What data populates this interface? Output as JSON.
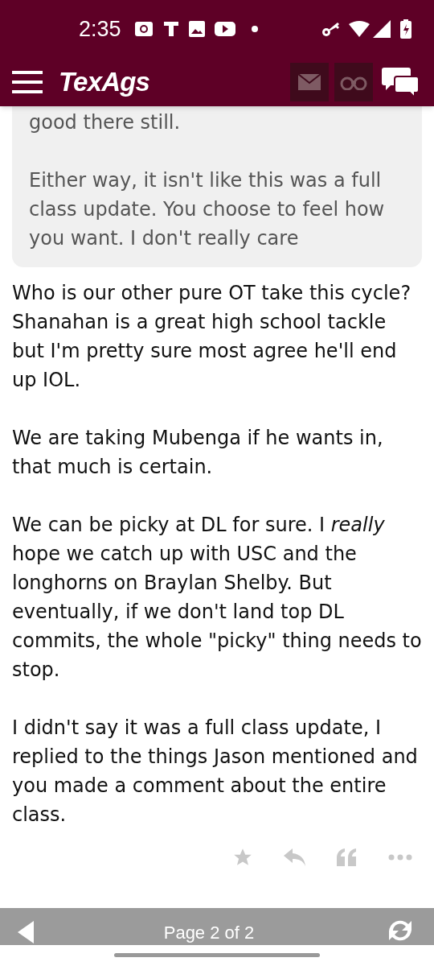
{
  "status_bar": {
    "time": "2:35"
  },
  "header": {
    "logo": "TexAgs"
  },
  "quote": {
    "paragraphs": [
      "good there still.",
      "Either way, it isn't like this was a full class update. You choose to feel how you want. I don't really care"
    ]
  },
  "post": {
    "paragraphs": [
      "Who is our other pure OT take this cycle? Shanahan is a great high school tackle but I'm pretty sure most agree he'll end up IOL.",
      "We are taking Mubenga if he wants in, that much is certain.",
      "We can be picky at DL for sure. I *really* hope we catch up with USC and the longhorns on Braylan Shelby. But eventually, if we don't land top DL commits, the whole \"picky\" thing needs to stop.",
      "I didn't say it was a full class update, I replied to the things Jason mentioned and you made a comment about the entire class."
    ]
  },
  "pager": {
    "label": "Page 2 of 2"
  }
}
